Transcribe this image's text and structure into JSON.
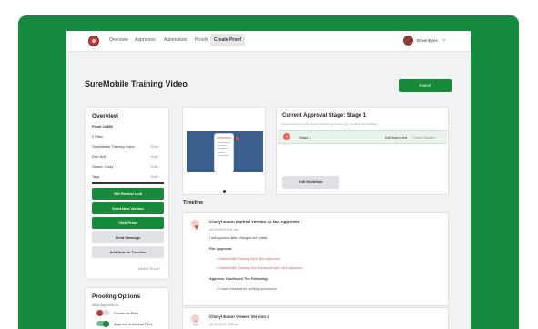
{
  "nav": {
    "items": [
      "Overview",
      "Approvers",
      "Automation",
      "Proofs",
      "Create Proof"
    ],
    "username": "BrownEyes"
  },
  "page": {
    "title": "SureMobile Training Video",
    "export_label": "Export"
  },
  "overview": {
    "title": "Overview",
    "proof_id": "Proof #4585",
    "files": "2 Files",
    "rows": [
      {
        "label": "SureMobile Training Video",
        "edit": "Edit"
      },
      {
        "label": "Due N/A",
        "edit": "Edit"
      },
      {
        "label": "Owner: Cody",
        "edit": "Edit"
      },
      {
        "label": "Tags",
        "edit": "Edit"
      }
    ],
    "buttons": [
      "Get Review Link",
      "Send New Version",
      "View Proof",
      "Send Message",
      "Add Note to Timeline"
    ],
    "delete_label": "Delete Proof?"
  },
  "proofing": {
    "title": "Proofing Options",
    "subtitle": "Allow Approvers to:",
    "options": [
      {
        "label": "Download Files",
        "on": false
      },
      {
        "label": "Approve Individual Files",
        "on": true
      }
    ]
  },
  "approval": {
    "title": "Current Approval Stage: Stage 1",
    "subtitle": "Set an approver to the priority, sharing your review link, or editing the workflow.",
    "stage": {
      "num": "1",
      "label": "Stage 1",
      "status": "Not Approved",
      "link": "View Details"
    },
    "edit_label": "Edit Workflow"
  },
  "timeline": {
    "title": "Timeline",
    "entries": [
      {
        "heading": "Cheryl Eaton Marked Version #2 Not Approved",
        "date": "06-22-2023 8:01 am",
        "message": "I will approve after changes are made.",
        "files_label": "File Approval:",
        "files": [
          "SureMobile Training.mp4: Not Approved",
          "SureMobile Training Rev Expected.mp4: Not Approved"
        ],
        "confirm_label": "Approver Confirmed The Following:",
        "confirm_items": [
          "I have checked for spelling and errors."
        ]
      },
      {
        "heading": "Cheryl Eaton Viewed Version 2",
        "date": "06-22-2023 7:58 am"
      }
    ]
  },
  "colors": {
    "accent": "#178a3c",
    "frame": "#168a3e",
    "danger": "#d05b5b"
  }
}
